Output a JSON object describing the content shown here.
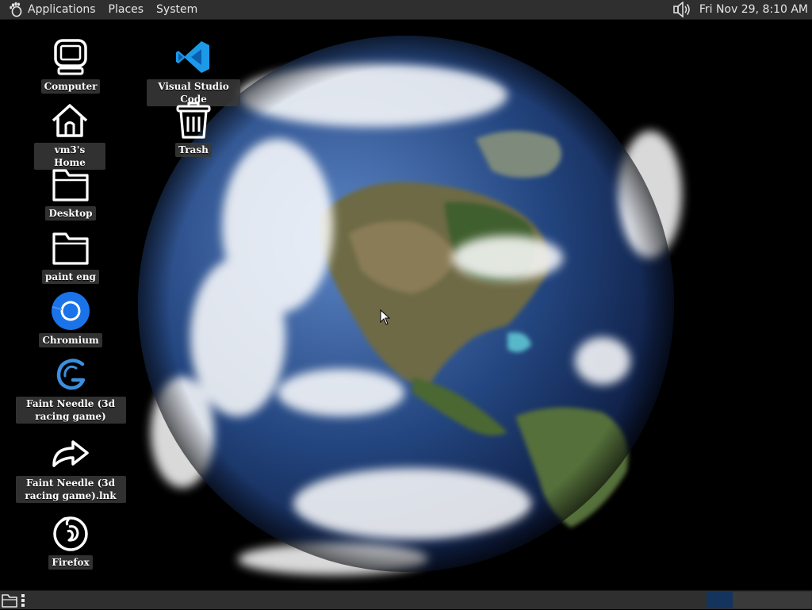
{
  "top_panel": {
    "menus": [
      "Applications",
      "Places",
      "System"
    ],
    "clock": "Fri Nov 29,  8:10 AM",
    "icons": [
      "gnome-foot-icon",
      "volume-icon"
    ]
  },
  "desktop": {
    "wallpaper": "earth-globe",
    "icons": [
      {
        "label": "Computer",
        "icon": "computer-icon"
      },
      {
        "label": "vm3's Home",
        "icon": "home-icon"
      },
      {
        "label": "Desktop",
        "icon": "folder-icon"
      },
      {
        "label": "paint eng",
        "icon": "folder-icon"
      },
      {
        "label": "Chromium",
        "icon": "chromium-icon"
      },
      {
        "label": "Faint Needle (3d racing game)",
        "icon": "game-icon"
      },
      {
        "label": "Faint Needle (3d racing game).lnk",
        "icon": "shortcut-icon"
      },
      {
        "label": "Firefox",
        "icon": "firefox-icon"
      },
      {
        "label": "Visual Studio Code",
        "icon": "vscode-icon"
      },
      {
        "label": "Trash",
        "icon": "trash-icon"
      }
    ]
  },
  "bottom_panel": {
    "icons": [
      "show-desktop-icon",
      "panel-handle-icon"
    ],
    "workspaces_count": 4,
    "active_workspace": 1
  },
  "colors": {
    "panel_bg": "#2f2f2f",
    "label_bg": "#3a3a3a",
    "active_workspace": "#14345e",
    "chromium_blue": "#1a73e8",
    "vscode_blue": "#1c9ae8"
  }
}
